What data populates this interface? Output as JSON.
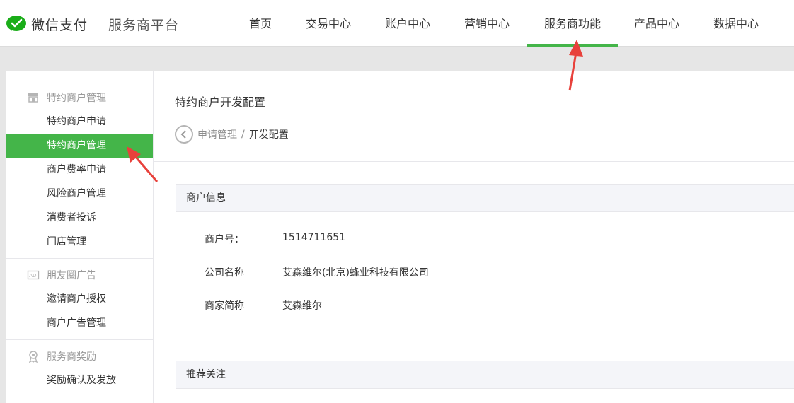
{
  "header": {
    "brand": "微信支付",
    "platform": "服务商平台",
    "nav": [
      {
        "label": "首页",
        "active": false
      },
      {
        "label": "交易中心",
        "active": false
      },
      {
        "label": "账户中心",
        "active": false
      },
      {
        "label": "营销中心",
        "active": false
      },
      {
        "label": "服务商功能",
        "active": true
      },
      {
        "label": "产品中心",
        "active": false
      },
      {
        "label": "数据中心",
        "active": false
      }
    ]
  },
  "sidebar": {
    "groups": [
      {
        "title": "特约商户管理",
        "icon": "store-icon",
        "items": [
          {
            "label": "特约商户申请",
            "active": false
          },
          {
            "label": "特约商户管理",
            "active": true
          },
          {
            "label": "商户费率申请",
            "active": false
          },
          {
            "label": "风险商户管理",
            "active": false
          },
          {
            "label": "消费者投诉",
            "active": false
          },
          {
            "label": "门店管理",
            "active": false
          }
        ]
      },
      {
        "title": "朋友圈广告",
        "icon": "ad-icon",
        "items": [
          {
            "label": "邀请商户授权",
            "active": false
          },
          {
            "label": "商户广告管理",
            "active": false
          }
        ]
      },
      {
        "title": "服务商奖励",
        "icon": "award-icon",
        "items": [
          {
            "label": "奖励确认及发放",
            "active": false
          }
        ]
      }
    ]
  },
  "main": {
    "title": "特约商户开发配置",
    "breadcrumb": {
      "parent": "申请管理",
      "separator": "/",
      "current": "开发配置"
    },
    "merchant_panel": {
      "header": "商户信息",
      "fields": [
        {
          "label": "商户号：",
          "value": "1514711651"
        },
        {
          "label": "公司名称",
          "value": "艾森维尔(北京)蜂业科技有限公司"
        },
        {
          "label": "商家简称",
          "value": "艾森维尔"
        }
      ]
    },
    "recommend_panel": {
      "header": "推荐关注"
    }
  },
  "colors": {
    "accent": "#44b549",
    "annotation": "#e8413b"
  }
}
